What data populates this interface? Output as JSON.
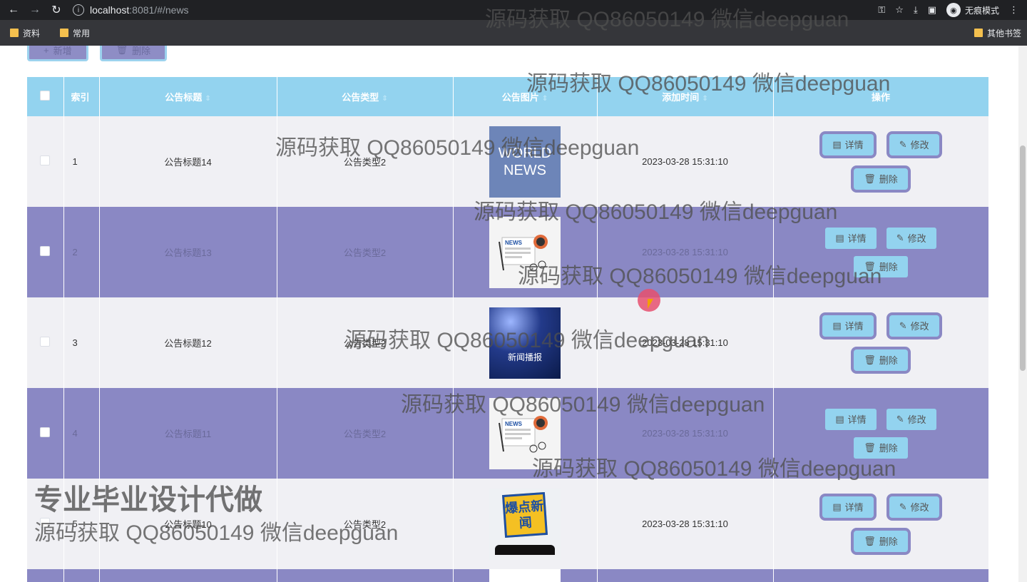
{
  "browser": {
    "url_host": "localhost",
    "url_path": ":8081/#/news",
    "incognito_label": "无痕模式",
    "bookmarks": [
      "资料",
      "常用"
    ],
    "other_bookmarks": "其他书签"
  },
  "toolbar": {
    "add_label": "新增",
    "delete_label": "删除"
  },
  "table": {
    "headers": {
      "index": "索引",
      "title": "公告标题",
      "type": "公告类型",
      "image": "公告图片",
      "time": "添加时间",
      "actions": "操作"
    },
    "rows": [
      {
        "index": "1",
        "title": "公告标题14",
        "type": "公告类型2",
        "time": "2023-03-28 15:31:10",
        "image": "world-news"
      },
      {
        "index": "2",
        "title": "公告标题13",
        "type": "公告类型2",
        "time": "2023-03-28 15:31:10",
        "image": "newspaper"
      },
      {
        "index": "3",
        "title": "公告标题12",
        "type": "公告类型2",
        "time": "2023-03-28 15:31:10",
        "image": "stage"
      },
      {
        "index": "4",
        "title": "公告标题11",
        "type": "公告类型2",
        "time": "2023-03-28 15:31:10",
        "image": "newspaper"
      },
      {
        "index": "5",
        "title": "公告标题10",
        "type": "公告类型2",
        "time": "2023-03-28 15:31:10",
        "image": "phone"
      }
    ],
    "actions": {
      "detail": "详情",
      "edit": "修改",
      "delete": "删除"
    },
    "image_text": {
      "world1": "WORLD",
      "world2": "NEWS",
      "news_label": "NEWS",
      "stage_label": "新闻播报",
      "badge": "爆点新闻"
    }
  },
  "watermarks": {
    "text": "源码获取 QQ86050149 微信deepguan",
    "big": "专业毕业设计代做"
  }
}
